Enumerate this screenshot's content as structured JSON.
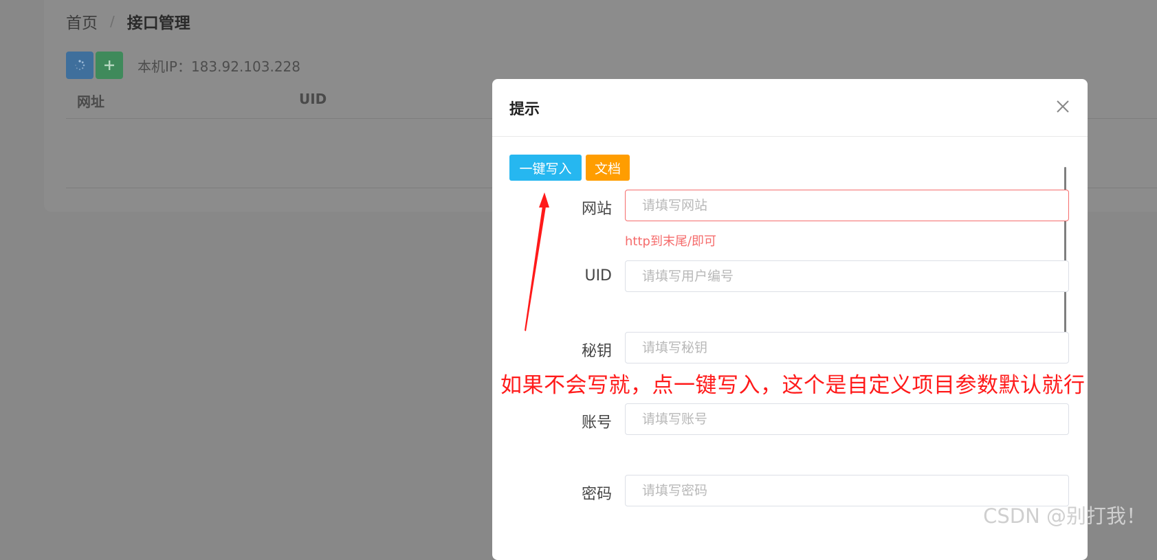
{
  "breadcrumb": {
    "home": "首页",
    "separator": "/",
    "current": "接口管理"
  },
  "toolbar": {
    "refresh_icon": "refresh-icon",
    "add_icon": "plus-icon",
    "ip_text": "本机IP：183.92.103.228"
  },
  "table": {
    "columns": [
      "网址",
      "UID"
    ]
  },
  "dialog": {
    "title": "提示",
    "close_icon": "close-icon",
    "one_click_label": "一键写入",
    "docs_label": "文档",
    "fields": {
      "website": {
        "label": "网站",
        "placeholder": "请填写网站",
        "error": "http到末尾/即可"
      },
      "uid": {
        "label": "UID",
        "placeholder": "请填写用户编号"
      },
      "secret": {
        "label": "秘钥",
        "placeholder": "请填写秘钥"
      },
      "account": {
        "label": "账号",
        "placeholder": "请填写账号"
      },
      "password": {
        "label": "密码",
        "placeholder": "请填写密码"
      }
    }
  },
  "annotation": {
    "text": "如果不会写就，点一键写入，这个是自定义项目参数默认就行",
    "color": "#ff1a1a"
  },
  "watermark": "CSDN @别打我！",
  "colors": {
    "primary_cyan": "#26b7f0",
    "warning_orange": "#ff9d00",
    "error_red": "#f56c6c"
  }
}
